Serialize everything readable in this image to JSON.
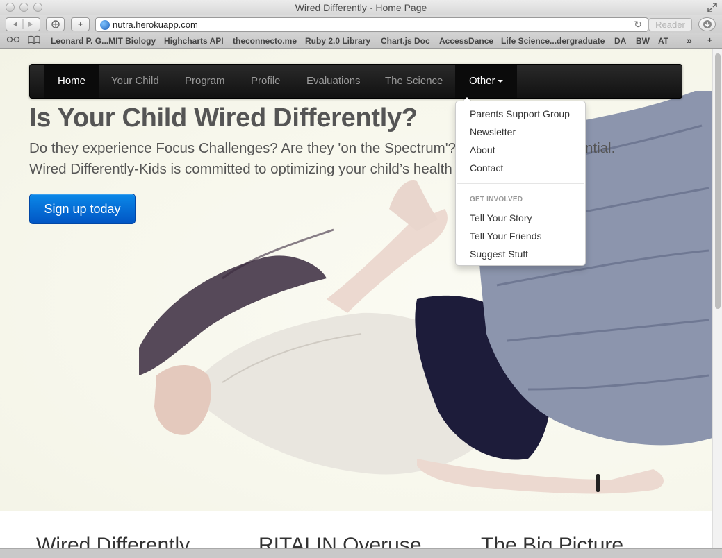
{
  "window": {
    "title": "Wired Differently · Home Page"
  },
  "toolbar": {
    "url": "nutra.herokuapp.com",
    "reader_label": "Reader",
    "new_tab_label": "+"
  },
  "bookmarks": {
    "items": [
      "Leonard P. G...MIT Biology",
      "Highcharts API",
      "theconnecto.me",
      "Ruby 2.0 Library",
      "Chart.js Doc",
      "AccessDance",
      "Life Science...dergraduate",
      "DA",
      "BW",
      "AT"
    ],
    "overflow": "»",
    "add": "+"
  },
  "navbar": {
    "items": [
      "Home",
      "Your Child",
      "Program",
      "Profile",
      "Evaluations",
      "The Science",
      "Other"
    ],
    "active": "Home",
    "open": "Other"
  },
  "dropdown": {
    "items": [
      "Parents Support Group",
      "Newsletter",
      "About",
      "Contact"
    ],
    "header": "GET INVOLVED",
    "items2": [
      "Tell Your Story",
      "Tell Your Friends",
      "Suggest Stuff"
    ]
  },
  "hero": {
    "headline": "Is Your Child Wired Differently?",
    "lead_line1_a": "Do they experience Focus Challenges? Are they 'on the Spectrum'?",
    "lead_line1_b": "ntial.",
    "lead_line2": "Wired Differently-Kids is committed to optimizing your child’s health",
    "cta": "Sign up today"
  },
  "columns": {
    "titles": [
      "Wired Differently",
      "RITALIN Overuse",
      "The Big Picture"
    ]
  }
}
